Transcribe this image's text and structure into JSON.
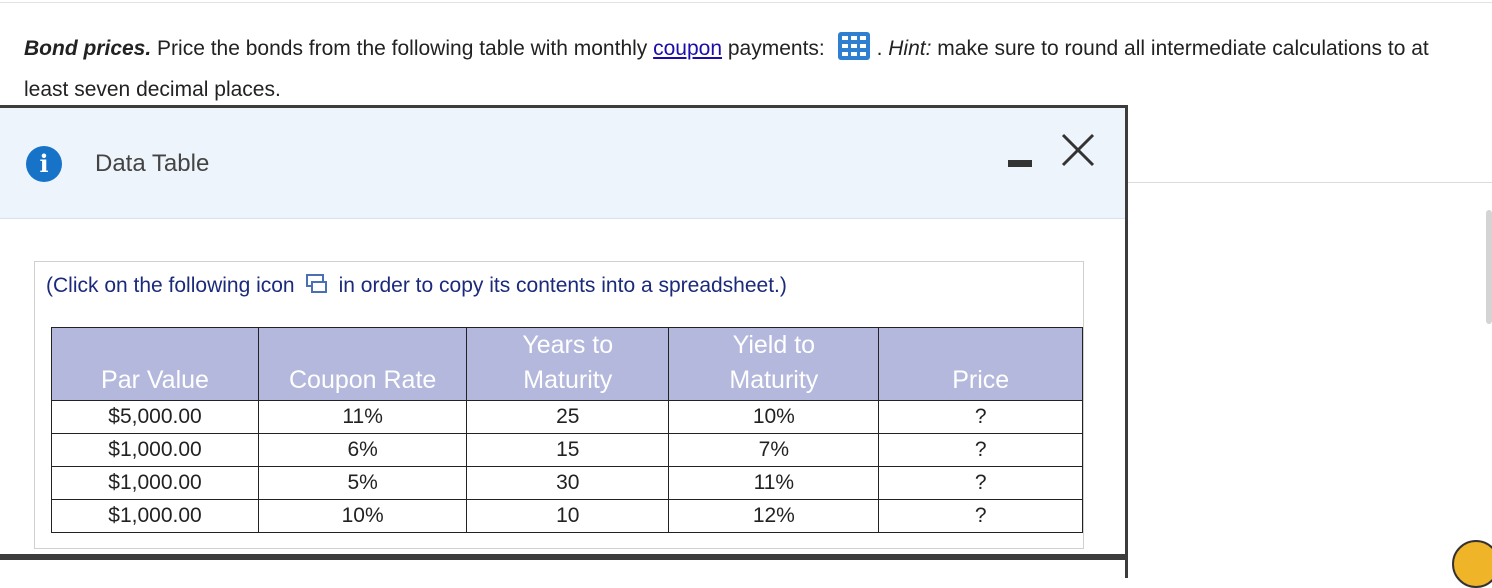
{
  "question": {
    "title": "Bond prices.",
    "text_before_link": " Price the bonds from the following table with monthly ",
    "link_text": "coupon",
    "text_after_link": " payments: ",
    "hint_label": "Hint:",
    "hint_text": " make sure to round all intermediate calculations to at least seven decimal places.",
    "period": ". "
  },
  "modal": {
    "title": "Data Table",
    "info_icon": "info-icon",
    "minimize_icon": "minimize-icon",
    "close_icon": "close-icon"
  },
  "copy_note": {
    "before": "(Click on the following icon",
    "after": "in order to copy its contents into a spreadsheet.)",
    "icon": "copy-to-spreadsheet-icon"
  },
  "table": {
    "headers": [
      {
        "line1": "",
        "line2": "Par Value"
      },
      {
        "line1": "",
        "line2": "Coupon Rate"
      },
      {
        "line1": "Years to",
        "line2": "Maturity"
      },
      {
        "line1": "Yield to",
        "line2": "Maturity"
      },
      {
        "line1": "",
        "line2": "Price"
      }
    ],
    "rows": [
      [
        "$5,000.00",
        "11%",
        "25",
        "10%",
        "?"
      ],
      [
        "$1,000.00",
        "6%",
        "15",
        "7%",
        "?"
      ],
      [
        "$1,000.00",
        "5%",
        "30",
        "11%",
        "?"
      ],
      [
        "$1,000.00",
        "10%",
        "10",
        "12%",
        "?"
      ]
    ]
  },
  "colors": {
    "header_bg": "#b4b8dc",
    "info_blue": "#1673c8",
    "link": "#1a0dab",
    "modal_header_bg": "#eef4fb"
  }
}
